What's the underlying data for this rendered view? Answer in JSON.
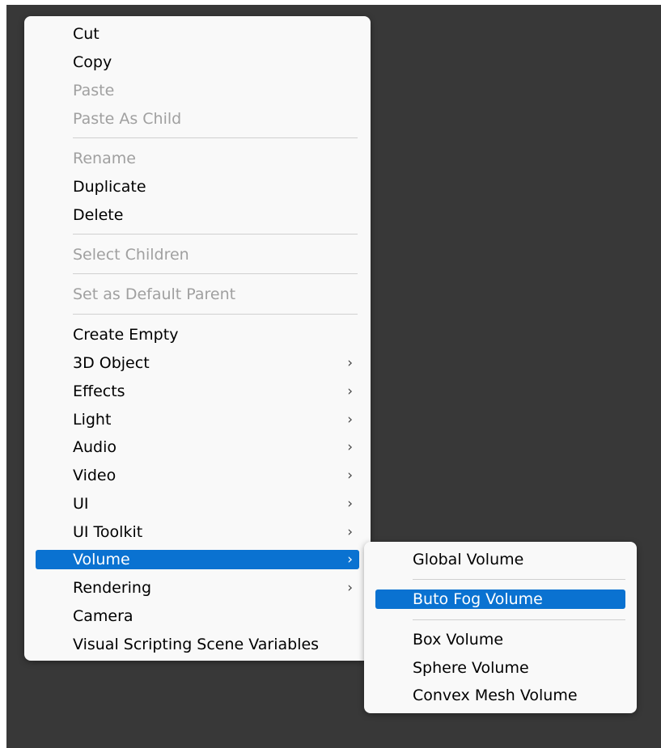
{
  "main_menu": {
    "items": [
      {
        "label": "Cut",
        "enabled": true
      },
      {
        "label": "Copy",
        "enabled": true
      },
      {
        "label": "Paste",
        "enabled": false
      },
      {
        "label": "Paste As Child",
        "enabled": false
      },
      {
        "label": "Rename",
        "enabled": false
      },
      {
        "label": "Duplicate",
        "enabled": true
      },
      {
        "label": "Delete",
        "enabled": true
      },
      {
        "label": "Select Children",
        "enabled": false
      },
      {
        "label": "Set as Default Parent",
        "enabled": false
      },
      {
        "label": "Create Empty",
        "enabled": true
      },
      {
        "label": "3D Object",
        "enabled": true,
        "has_submenu": true
      },
      {
        "label": "Effects",
        "enabled": true,
        "has_submenu": true
      },
      {
        "label": "Light",
        "enabled": true,
        "has_submenu": true
      },
      {
        "label": "Audio",
        "enabled": true,
        "has_submenu": true
      },
      {
        "label": "Video",
        "enabled": true,
        "has_submenu": true
      },
      {
        "label": "UI",
        "enabled": true,
        "has_submenu": true
      },
      {
        "label": "UI Toolkit",
        "enabled": true,
        "has_submenu": true
      },
      {
        "label": "Volume",
        "enabled": true,
        "has_submenu": true,
        "highlighted": true
      },
      {
        "label": "Rendering",
        "enabled": true,
        "has_submenu": true
      },
      {
        "label": "Camera",
        "enabled": true
      },
      {
        "label": "Visual Scripting Scene Variables",
        "enabled": true
      }
    ],
    "submenu_arrow": "›"
  },
  "volume_submenu": {
    "items": [
      {
        "label": "Global Volume",
        "enabled": true
      },
      {
        "label": "Buto Fog Volume",
        "enabled": true,
        "highlighted": true
      },
      {
        "label": "Box Volume",
        "enabled": true
      },
      {
        "label": "Sphere Volume",
        "enabled": true
      },
      {
        "label": "Convex Mesh Volume",
        "enabled": true
      }
    ]
  },
  "colors": {
    "highlight": "#0a72d1",
    "background": "#383838",
    "menu_background": "#f9f9f9",
    "disabled_text": "#a0a0a0"
  }
}
